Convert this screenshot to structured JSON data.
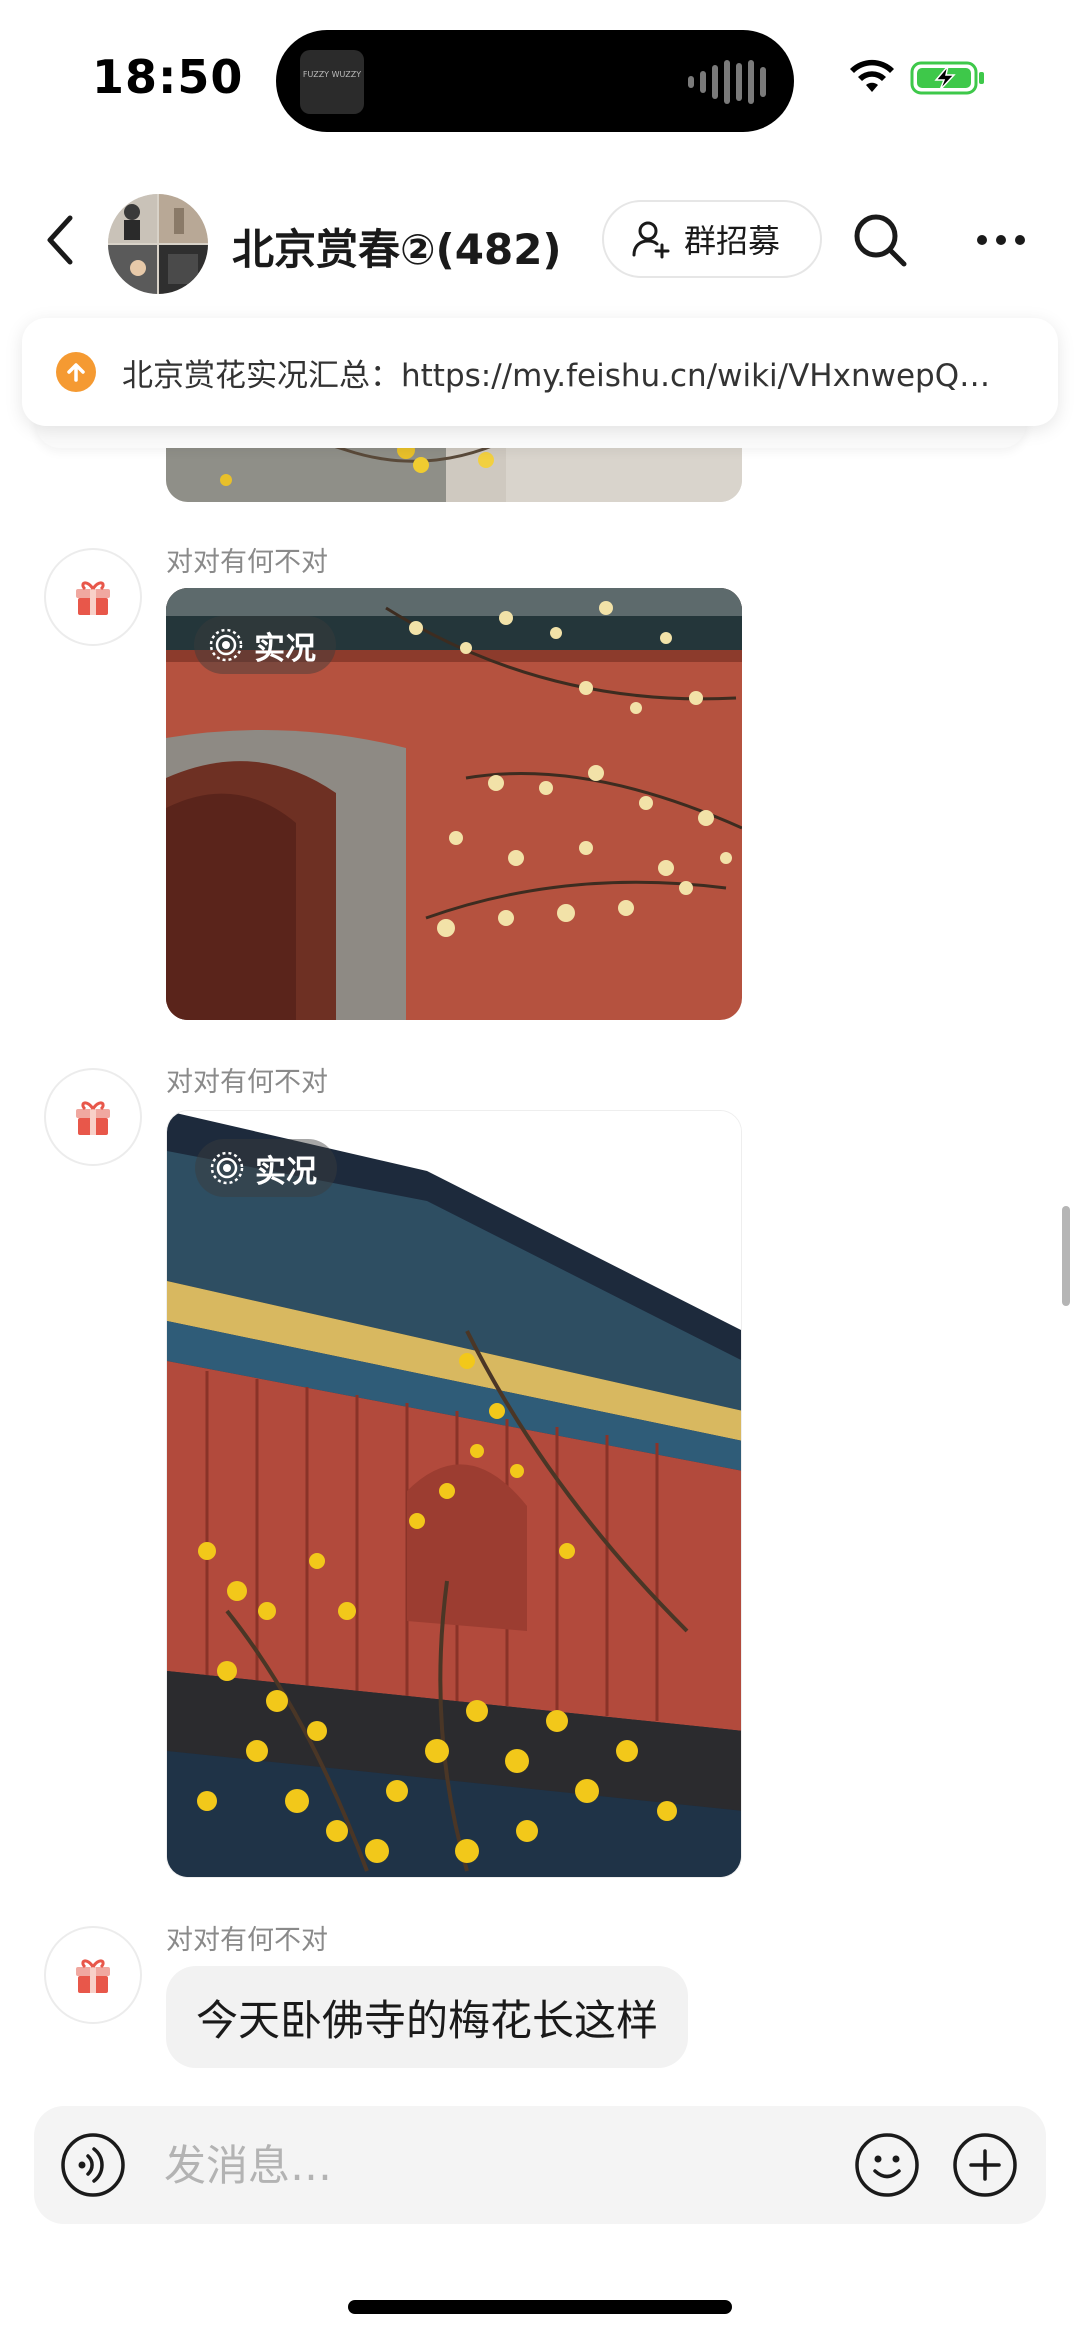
{
  "status_bar": {
    "time": "18:50",
    "island_thumb_text": "FUZZY WUZZY",
    "battery_color": "#3ec84a"
  },
  "header": {
    "group_title": "北京赏春②(482)",
    "recruit_label": "群招募",
    "icons": [
      "back-icon",
      "group-avatar",
      "person-add-icon",
      "search-icon",
      "more-icon"
    ]
  },
  "pinned": {
    "text": "北京赏花实况汇总：https://my.feishu.cn/wiki/VHxnwepQ…",
    "icon": "upload-arrow-icon",
    "icon_color": "#f59a32"
  },
  "messages": [
    {
      "sender": "对对有何不对",
      "type": "live-photo",
      "live_label": "实况",
      "photo_description_icon": "gift-icon"
    },
    {
      "sender": "对对有何不对",
      "type": "live-photo",
      "live_label": "实况",
      "photo_description_icon": "gift-icon"
    },
    {
      "sender": "对对有何不对",
      "type": "text",
      "text": "今天卧佛寺的梅花长这样"
    }
  ],
  "input_bar": {
    "placeholder": "发消息…",
    "icons": [
      "voice-icon",
      "emoji-icon",
      "plus-icon"
    ]
  }
}
